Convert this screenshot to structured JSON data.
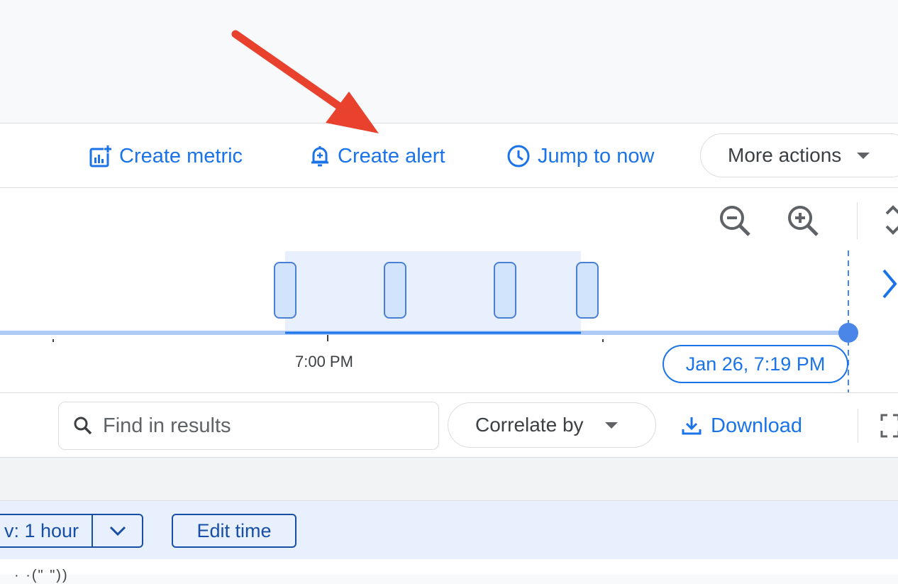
{
  "toolbar": {
    "create_metric": "Create metric",
    "create_alert": "Create alert",
    "jump_to_now": "Jump to now",
    "more_actions": "More actions"
  },
  "histogram": {
    "time_tick_label": "7:00 PM",
    "now_label": "Jan 26, 7:19 PM"
  },
  "results_bar": {
    "find_placeholder": "Find in results",
    "correlate_by": "Correlate by",
    "download": "Download"
  },
  "info_bar": {
    "window_label": "v: 1 hour",
    "edit_time": "Edit time"
  },
  "bottom": {
    "partial_text": "· ·(\" \"))"
  },
  "colors": {
    "accent": "#1a73e8",
    "dark_blue": "#174ea6",
    "annotation_arrow": "#e8412e",
    "histogram_bar_fill": "#d2e3fc",
    "selection_fill": "#e8f0fe"
  },
  "icons": {
    "create_metric": "metric-chart-icon",
    "create_alert": "alert-bell-icon",
    "jump_to_now": "clock-icon",
    "zoom_out": "zoom-out-icon",
    "zoom_in": "zoom-in-icon",
    "expand": "expand-vertical-icon",
    "next": "chevron-right-icon",
    "find": "search-icon",
    "download": "download-icon",
    "fullscreen": "fullscreen-icon",
    "window_dropdown": "chevron-down-icon"
  }
}
